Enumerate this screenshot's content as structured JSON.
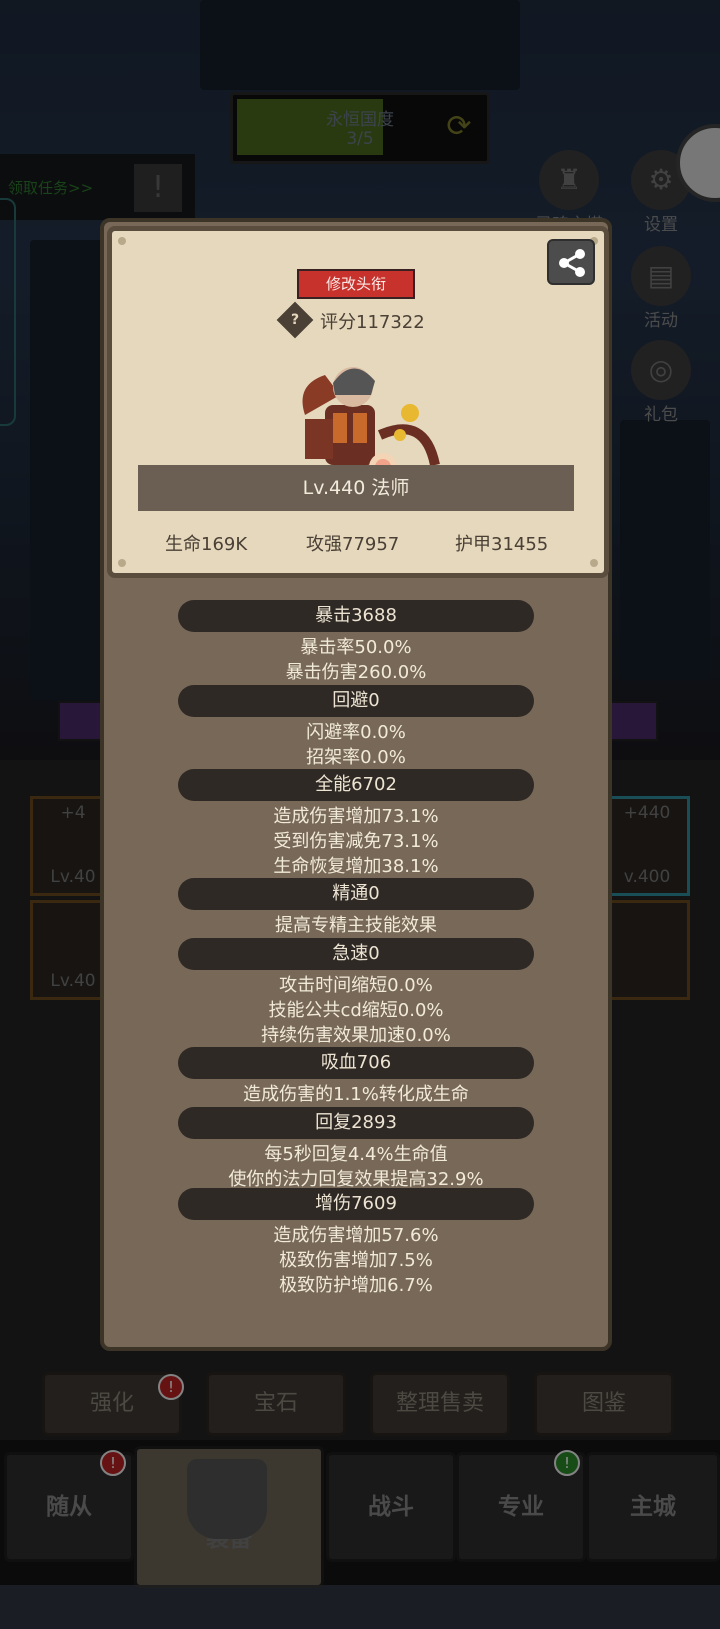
{
  "background": {
    "realm_name": "永恒国度",
    "realm_progress": "3/5",
    "quest_label": "领取任务>>",
    "tower_label": "灵魂之塔",
    "side_menu": [
      {
        "label": "设置",
        "icon": "gear-icon"
      },
      {
        "label": "活动",
        "icon": "scroll-icon"
      },
      {
        "label": "礼包",
        "icon": "gift-icon"
      }
    ],
    "gear_slots": [
      {
        "plus": "+4",
        "level": "Lv.40"
      },
      {
        "plus": "",
        "level": "Lv.40"
      },
      {
        "plus": "+440",
        "level": "v.400"
      },
      {
        "plus": "",
        "level": ""
      }
    ],
    "actions": [
      "强化",
      "宝石",
      "整理售卖",
      "图鉴"
    ],
    "nav": [
      "随从",
      "装备",
      "战斗",
      "专业",
      "主城"
    ],
    "badge_mark": "!"
  },
  "profile": {
    "edit_title_label": "修改头衔",
    "help_icon": "?",
    "score": "评分117322",
    "level_class": "Lv.440 法师",
    "stats": {
      "hp": "生命169K",
      "attack": "攻强77957",
      "armor": "护甲31455"
    }
  },
  "attributes": [
    {
      "title": "暴击3688",
      "lines": [
        "暴击率50.0%",
        "暴击伤害260.0%"
      ]
    },
    {
      "title": "回避0",
      "lines": [
        "闪避率0.0%",
        "招架率0.0%"
      ]
    },
    {
      "title": "全能6702",
      "lines": [
        "造成伤害增加73.1%",
        "受到伤害减免73.1%",
        "生命恢复增加38.1%"
      ]
    },
    {
      "title": "精通0",
      "lines": [
        "提高专精主技能效果"
      ]
    },
    {
      "title": "急速0",
      "lines": [
        "攻击时间缩短0.0%",
        "技能公共cd缩短0.0%",
        "持续伤害效果加速0.0%"
      ]
    },
    {
      "title": "吸血706",
      "lines": [
        "造成伤害的1.1%转化成生命"
      ]
    },
    {
      "title": "回复2893",
      "lines": [
        "每5秒回复4.4%生命值",
        "使你的法力回复效果提高32.9%"
      ]
    },
    {
      "title": "增伤7609",
      "lines": [
        "造成伤害增加57.6%",
        "极致伤害增加7.5%",
        "极致防护增加6.7%"
      ]
    }
  ]
}
